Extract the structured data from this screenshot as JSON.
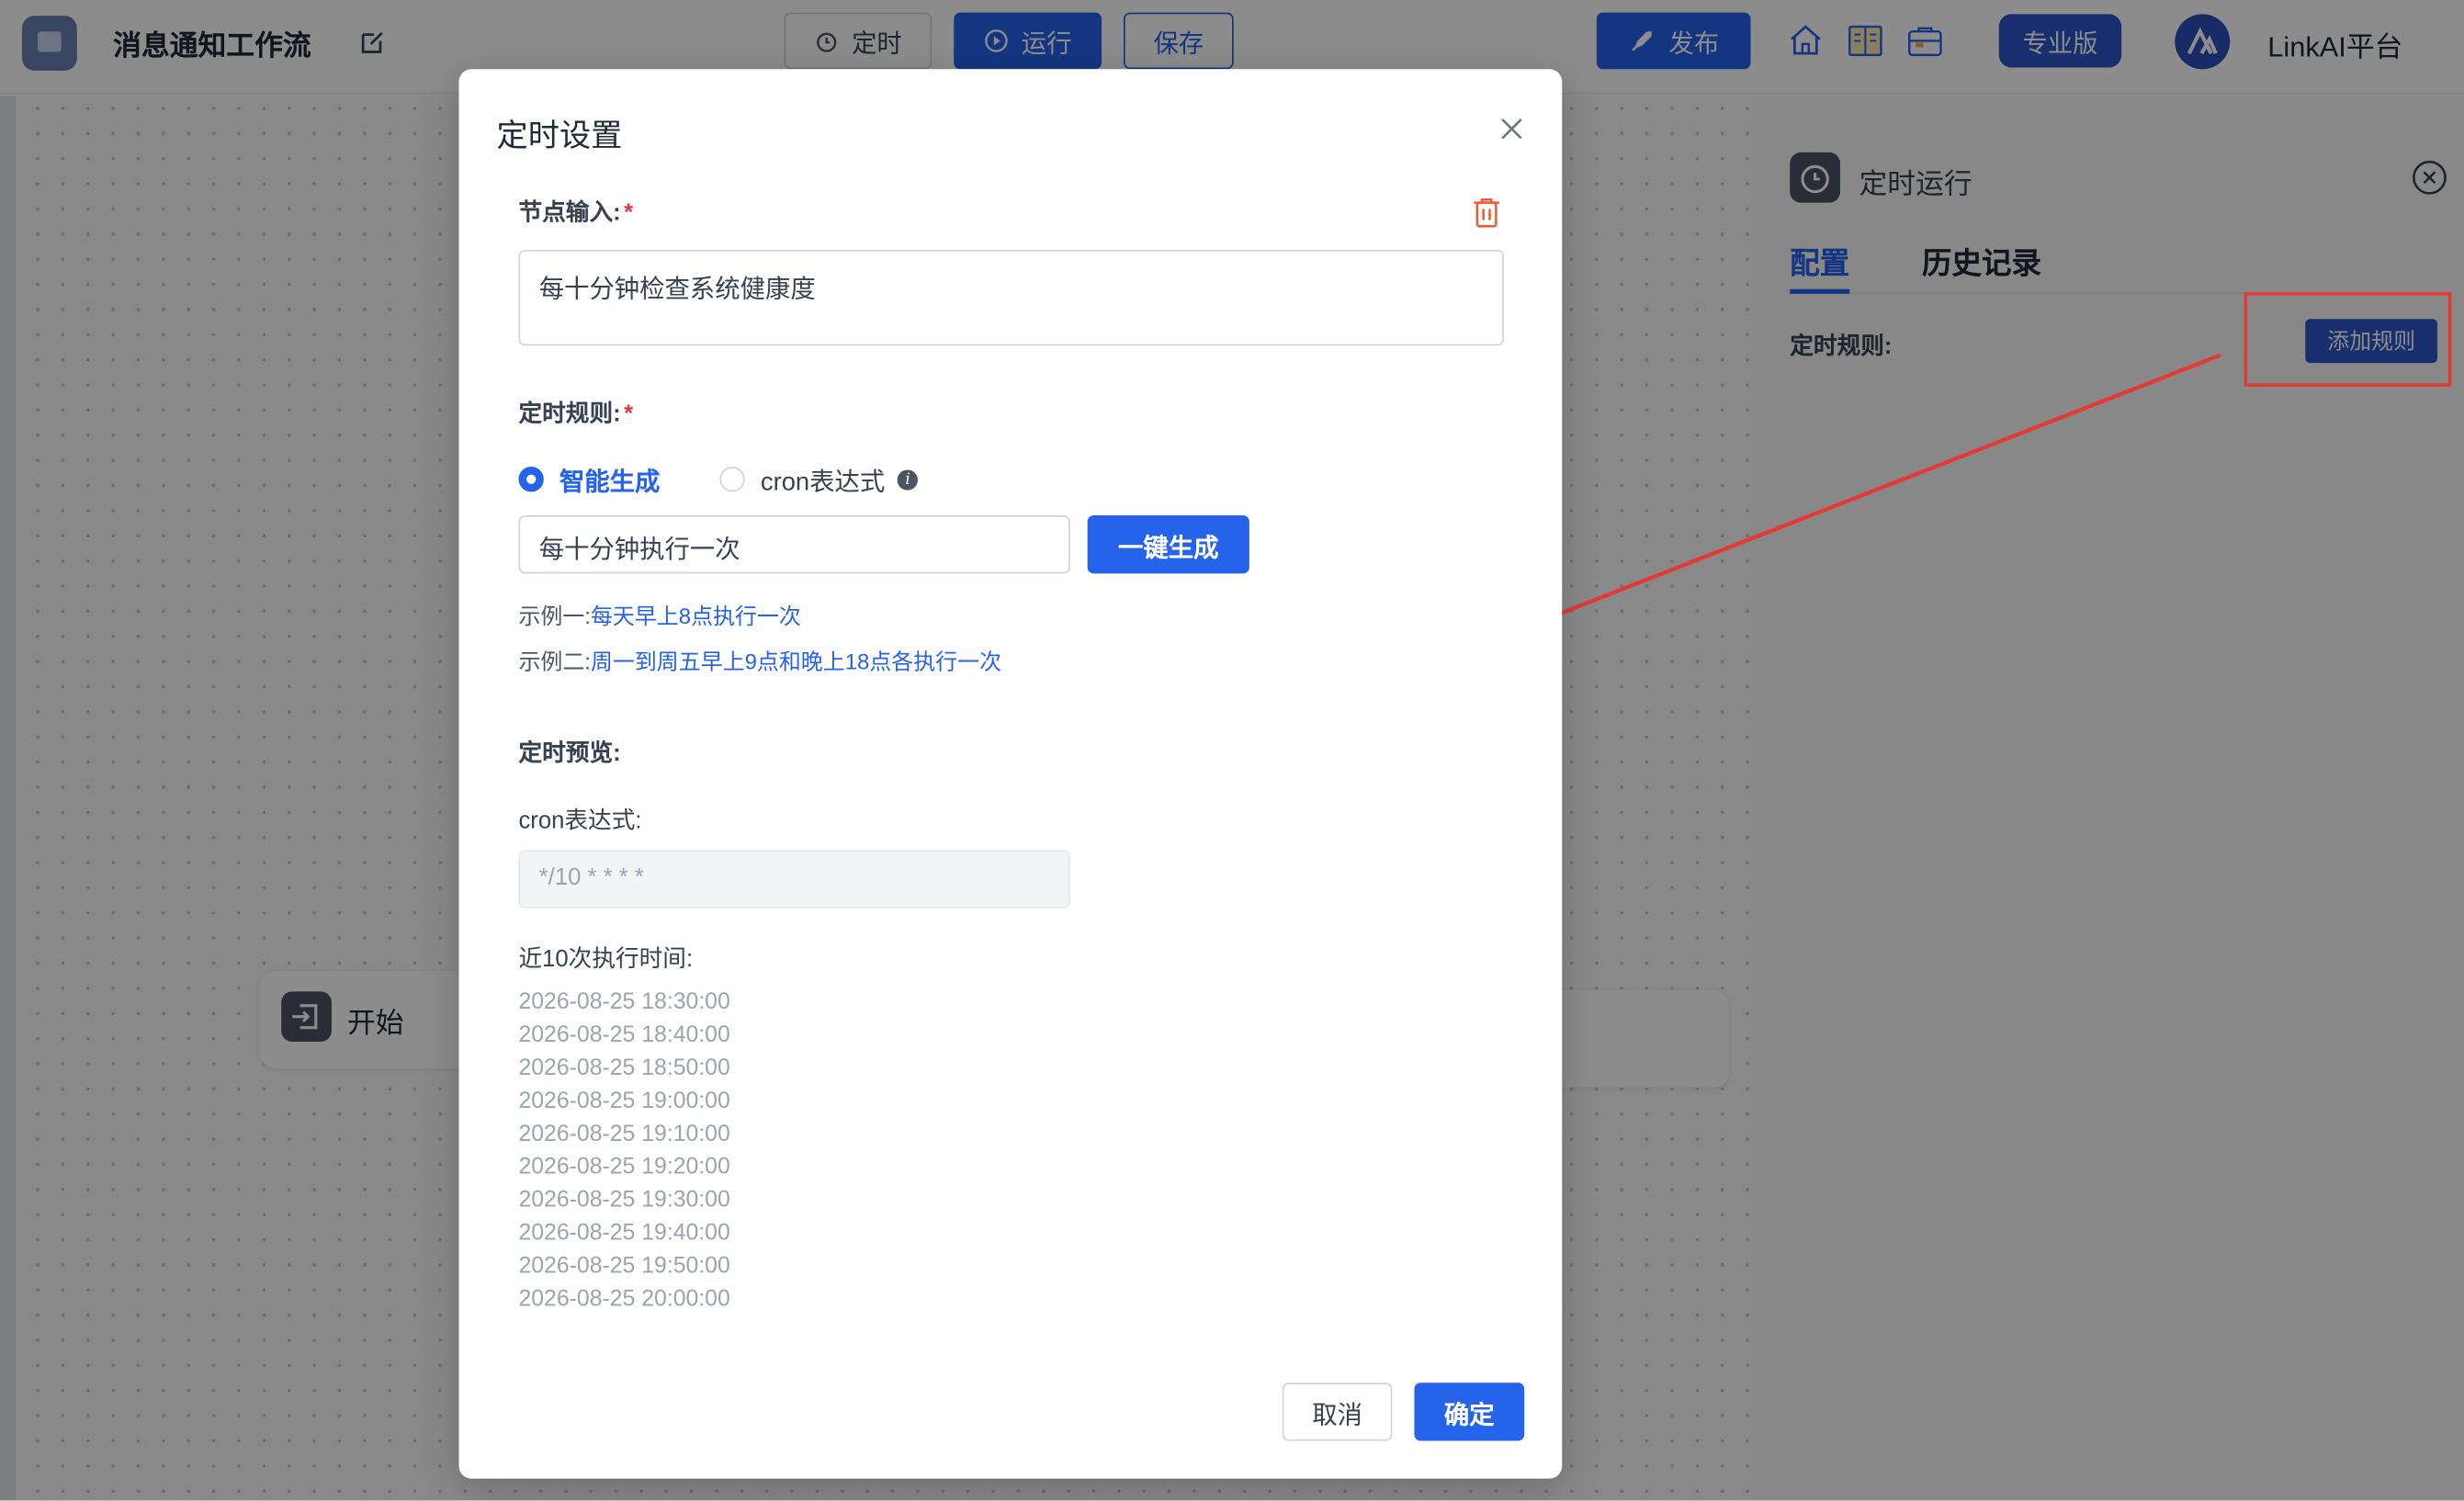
{
  "header": {
    "app_title": "消息通知工作流",
    "timer_label": "定时",
    "run_label": "运行",
    "save_label": "保存",
    "publish_label": "发布",
    "pro_label": "专业版",
    "platform_label": "LinkAI平台"
  },
  "canvas": {
    "start_node_label": "开始"
  },
  "side_panel": {
    "title": "定时运行",
    "tab_config": "配置",
    "tab_history": "历史记录",
    "rule_label": "定时规则:",
    "add_rule_label": "添加规则"
  },
  "modal": {
    "title": "定时设置",
    "node_input_label": "节点输入:",
    "node_input_value": "每十分钟检查系统健康度",
    "rule_label": "定时规则:",
    "required_mark": "*",
    "option_smart": "智能生成",
    "option_cron": "cron表达式",
    "nl_input_value": "每十分钟执行一次",
    "generate_label": "一键生成",
    "example1_prefix": "示例一:",
    "example1_link": "每天早上8点执行一次",
    "example2_prefix": "示例二:",
    "example2_link": "周一到周五早上9点和晚上18点各执行一次",
    "preview_label": "定时预览:",
    "cron_label": "cron表达式:",
    "cron_value": "*/10 * * * *",
    "times_label": "近10次执行时间:",
    "times": [
      "2026-08-25 18:30:00",
      "2026-08-25 18:40:00",
      "2026-08-25 18:50:00",
      "2026-08-25 19:00:00",
      "2026-08-25 19:10:00",
      "2026-08-25 19:20:00",
      "2026-08-25 19:30:00",
      "2026-08-25 19:40:00",
      "2026-08-25 19:50:00",
      "2026-08-25 20:00:00"
    ],
    "cancel_label": "取消",
    "ok_label": "确定"
  },
  "colors": {
    "primary": "#2563eb",
    "danger": "#e53935"
  }
}
